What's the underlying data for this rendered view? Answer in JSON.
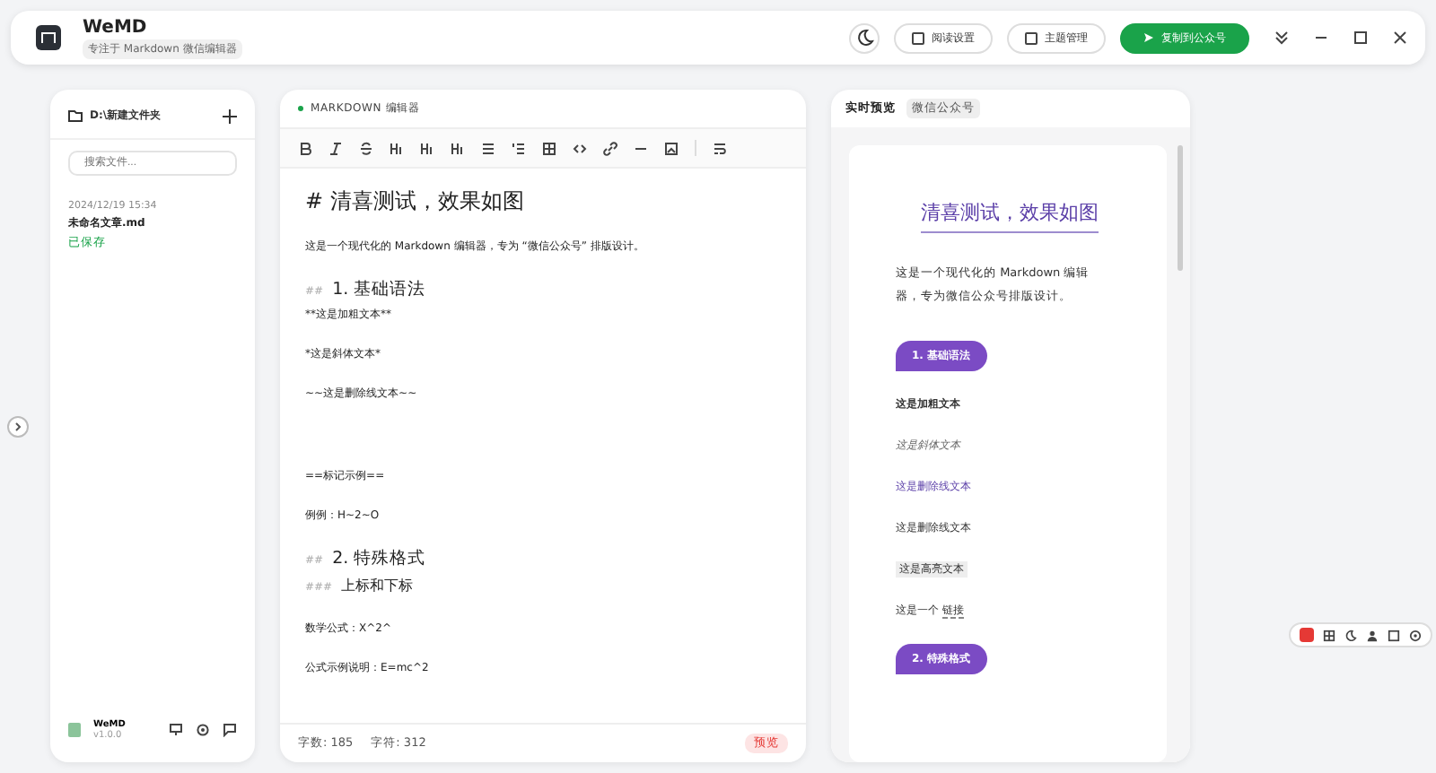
{
  "app": {
    "title": "WeMD",
    "subtitle": "专注于 Markdown 微信编辑器"
  },
  "header_actions": [
    {
      "kind": "icon"
    },
    {
      "kind": "button",
      "label": "阅读设置"
    },
    {
      "kind": "button",
      "label": "主题管理"
    },
    {
      "kind": "primary",
      "label": "复制到公众号"
    }
  ],
  "sidebar": {
    "folder": "D:\\新建文件夹",
    "search_placeholder": "搜索文件...",
    "files": [
      {
        "date": "2024/12/19 15:34",
        "name": "未命名文章.md",
        "status": "已保存",
        "selected": true
      }
    ],
    "footer_title": "WeMD",
    "footer_version": "v1.0.0"
  },
  "editor": {
    "label": "MARKDOWN 编辑器",
    "lines": [
      {
        "kind": "h1",
        "text": "# 清喜测试，效果如图"
      },
      {
        "kind": "p",
        "text": "这是一个现代化的 Markdown 编辑器，专为 “微信公众号” 排版设计。"
      },
      {
        "kind": "h2",
        "mark": "##",
        "text": "1. 基础语法"
      },
      {
        "kind": "p",
        "text": "**这是加粗文本**"
      },
      {
        "kind": "p",
        "text": "*这是斜体文本*"
      },
      {
        "kind": "p",
        "text": "~~这是删除线文本~~"
      },
      {
        "kind": "gap"
      },
      {
        "kind": "p",
        "text": "==标记示例=="
      },
      {
        "kind": "p",
        "text": "例例：H~2~O"
      },
      {
        "kind": "h2",
        "mark": "##",
        "text": "2. 特殊格式"
      },
      {
        "kind": "h3",
        "mark": "###",
        "text": "上标和下标"
      },
      {
        "kind": "p",
        "text": "数学公式：X^2^"
      },
      {
        "kind": "p",
        "text": "公式示例说明：E=mc^2"
      }
    ],
    "word_count": "字数: 185",
    "char_count": "字符: 312",
    "badge": "预览"
  },
  "preview": {
    "tab": "实时预览",
    "tag": "微信公众号",
    "title": "清喜测试，效果如图",
    "items": [
      {
        "kind": "p",
        "text": "这是一个现代化的 Markdown 编辑器，专为微信公众号排版设计。"
      },
      {
        "kind": "section",
        "text": "1. 基础语法"
      },
      {
        "kind": "bold",
        "text": "这是加粗文本"
      },
      {
        "kind": "italic",
        "text": "这是斜体文本"
      },
      {
        "kind": "accent",
        "text": "这是删除线文本"
      },
      {
        "kind": "plain",
        "text": "这是删除线文本"
      },
      {
        "kind": "highlight",
        "text": "这是高亮文本"
      },
      {
        "kind": "link",
        "text": "这是一个",
        "link": "链接"
      },
      {
        "kind": "section",
        "text": "2. 特殊格式"
      }
    ]
  }
}
